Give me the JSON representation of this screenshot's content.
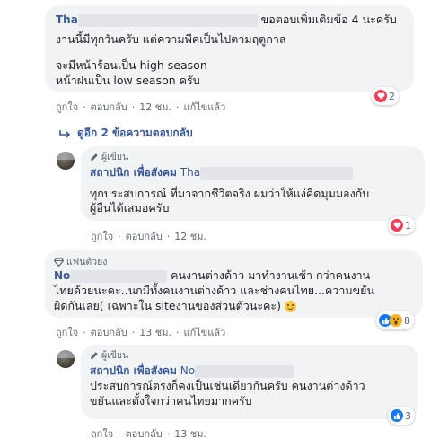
{
  "comment1": {
    "author_visible": "Tha",
    "text_line1": "ขอตอบเพิ่มเติมข้อ 4 นะครับ",
    "text_line2": "งานนี้มีทุกวันครับ แต่ความพีคเป็นไปตามฤดูกาล",
    "text_line3": "จะมีหน้าร้อนเป็น high season",
    "text_line4": "หน้าฝนเป็น low season ครับ",
    "reaction_count": "2",
    "like_label": "ถูกใจ",
    "reply_label": "ตอบกลับ",
    "time": "12 ชม.",
    "edited_label": "แก้ไขแล้ว"
  },
  "more_replies_label": "ดูอีก 2 ข้อความตอบกลับ",
  "reply1": {
    "badge_label": "ผู้เขียน",
    "author": "สถาปนิก เพื่อสังคม",
    "mention_visible": "Tha",
    "text_line1": "ทุกประสบการณ์ ที่มาจากชีวิตจริง ผมว่าให้แง่คิดมุมมองกับ",
    "text_line2": "ผู้อื่นได้เสมอครับ",
    "reaction_count": "1",
    "like_label": "ถูกใจ",
    "reply_label": "ตอบกลับ",
    "time": "12 ชม."
  },
  "comment2": {
    "badge_label": "แฟนตัวยง",
    "author_visible": "No",
    "text_line1": "คนงานต่างด้าว มาทำงานเช้า กว่าคนงาน",
    "text_line2": "ไทยด้วยนะคะ..นกมีทั้งคนงานต่างด้าว และช่างคนไทย...ความขยัน",
    "text_line3": "ผิดกันเลย( เฉพาะใน siteงานของส่วนตัวนะคะ)",
    "reaction_count": "8",
    "like_label": "ถูกใจ",
    "reply_label": "ตอบกลับ",
    "time": "13 ชม.",
    "edited_label": "แก้ไขแล้ว"
  },
  "reply2": {
    "badge_label": "ผู้เขียน",
    "author": "สถาปนิก เพื่อสังคม",
    "mention_visible": "No",
    "text_line1": "ประสบการณ์ตรงก็คงเป็นเช่นเดียวกันครับ คนงานต่างด้าว",
    "text_line2": "ขยันและตั้งใจกว่าคนไทยมากครับ",
    "reaction_count": "3",
    "like_label": "ถูกใจ",
    "reply_label": "ตอบกลับ",
    "time": "13 ชม."
  },
  "colors": {
    "link": "#385898",
    "bubble": "#f2f3f5",
    "heart": "#f33e58",
    "like": "#1877f2",
    "wow": "#f7b125"
  }
}
